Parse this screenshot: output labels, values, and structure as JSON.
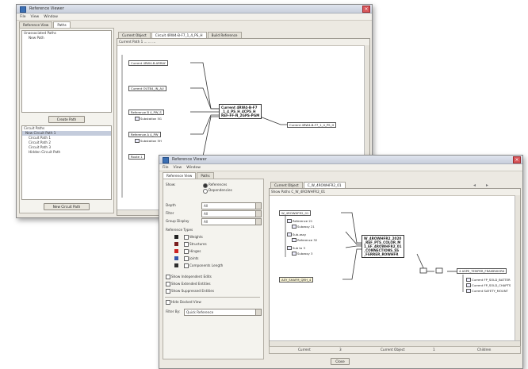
{
  "back_window": {
    "title": "Reference Viewer",
    "menu": [
      "File",
      "View",
      "Window"
    ],
    "left_tabs": [
      "Reference View",
      "Paths"
    ],
    "top_list_header": "Unassociated Paths",
    "top_list_item": "New Path",
    "create_button": "Create Path",
    "bottom_list_header": "Circuit Paths",
    "bottom_list_items": [
      "New Circuit Path 1",
      "Circuit Path 1",
      "Circuit Path 2",
      "Circuit Path 3",
      "Hidden Circuit Path"
    ],
    "new_button": "New Circuit Path",
    "right_tabs": [
      "Current Object",
      "Circuit 4RW4-B-F7_1_4_PS_H",
      "Build Reference"
    ],
    "toolbar": "Current Path 1  ...  ...  ...",
    "nodes": [
      "Current 4RW4-B-ARRAY",
      "Current OUTB4_IN_AU",
      "Reference B 4_PW_S",
      "Substation 5G",
      "Reference A 4_PW",
      "Substation 5H",
      "Route 1"
    ],
    "center_node": "Current 4RW4-B-F7\n_1_4_PS_H_4CPS_H\nREF-FF-N_2GPS-PGM",
    "target_node": "Current 4RW4-B-F7_1_4_PS_H"
  },
  "front_window": {
    "title": "Reference Viewer",
    "menu": [
      "File",
      "View",
      "Window"
    ],
    "left_tabs": [
      "Reference View",
      "Paths"
    ],
    "show_label": "Show:",
    "show_options": [
      "References",
      "Dependencies"
    ],
    "field_labels": [
      "Depth",
      "Filter",
      "Group Display"
    ],
    "field_values": [
      "All",
      "All",
      "All"
    ],
    "ref_types_label": "Reference Types",
    "ref_types": [
      "Weights",
      "Structures",
      "Hinges",
      "Joints",
      "Components Length"
    ],
    "ref_colors": [
      "#222222",
      "#7a1f1f",
      "#cc2222",
      "#3355aa",
      "#2e2e2e"
    ],
    "option_checks": [
      "Show Independent Edits",
      "Show Extended Entities",
      "Show Suppressed Entities"
    ],
    "dock_label": "Hide Docked View",
    "filter_label": "Filter By:",
    "filter_value": "Quick Reference",
    "right_tabs": [
      "Current Object",
      "C_W_4ROWHFR2_01"
    ],
    "toolbar": "Show Paths  C_W_4ROWHFR2_01",
    "root_node": "W_4ROWHFR2_01",
    "child_nodes": [
      "Reference 21",
      "Subassy 21",
      "Sub-assy",
      "Reference 32",
      "Sub to 3",
      "Subassy 3"
    ],
    "bottom_node": "ASY_SHAFM_QRH_4",
    "center_node": "W_4ROWHFR2_2020\n_REF_PTS_COLOR_M\n1_EF_4ROWHFR2_01\n_CONNECTIONS_SS\n_FERRER_ROWHFR",
    "target_node": "4 ASPE_TEMPER_FRAMEWORK",
    "target_children": [
      "Current FP_SOLD_BATTER",
      "Current FP_SOLD_CHAPTS",
      "Current SAFETY_MOUNT"
    ],
    "status_cols": [
      "Current",
      "3",
      "Current Object",
      "1",
      "Children"
    ],
    "close_button": "Close"
  }
}
